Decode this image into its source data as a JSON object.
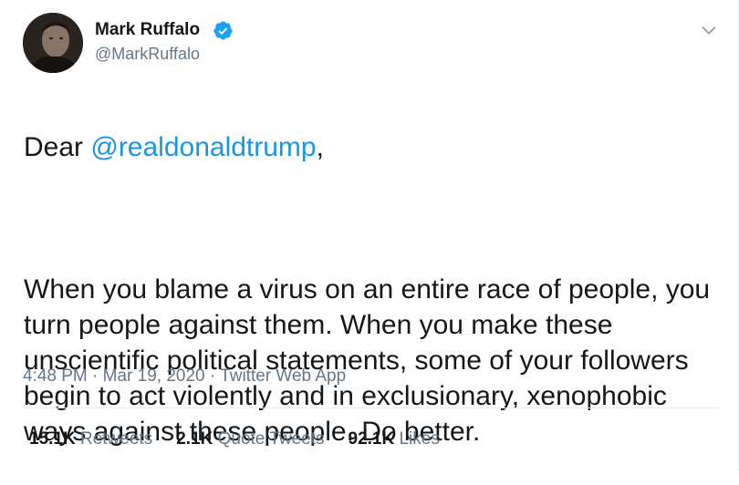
{
  "author": {
    "name": "Mark Ruffalo",
    "handle": "@MarkRuffalo"
  },
  "tweet": {
    "greeting": "Dear ",
    "mention": "@realdonaldtrump",
    "greeting_end": ",",
    "body": "When you blame a virus on an entire race of people, you turn people against them. When you make these unscientific political statements, some of your followers begin to act violently and in exclusionary, xenophobic ways against these people. Do better."
  },
  "meta": {
    "time": "4:48 PM",
    "sep1": " · ",
    "date": "Mar 19, 2020",
    "sep2": " · ",
    "source": "Twitter Web App"
  },
  "stats": {
    "retweets_count": "15.1K",
    "retweets_label": "Retweets",
    "quotes_count": "2.1K",
    "quotes_label": "Quote Tweets",
    "likes_count": "92.1K",
    "likes_label": "Likes"
  },
  "colors": {
    "link": "#1b95e0",
    "muted": "#657786",
    "text": "#14171a",
    "verified": "#1da1f2"
  },
  "icons": [
    "verified-badge-icon",
    "chevron-down-icon"
  ]
}
